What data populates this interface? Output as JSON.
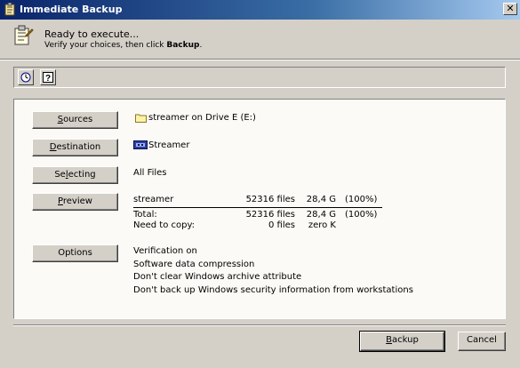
{
  "window": {
    "title": "Immediate Backup",
    "close_label": "✕"
  },
  "header": {
    "line1": "Ready to execute...",
    "line2_prefix": "Verify your choices, then click ",
    "line2_bold": "Backup",
    "line2_suffix": "."
  },
  "toolbar": {
    "icons": [
      "clock-icon",
      "help-icon"
    ]
  },
  "rows": {
    "sources": {
      "button_label_u": "S",
      "button_label_rest": "ources",
      "value": "streamer on Drive E (E:)",
      "icon": "folder-icon"
    },
    "destination": {
      "button_label_u": "D",
      "button_label_rest": "estination",
      "value": "Streamer",
      "icon": "tape-drive-icon"
    },
    "selecting": {
      "button_label_pre": "Se",
      "button_label_u": "l",
      "button_label_rest": "ecting",
      "value": "All Files"
    },
    "preview": {
      "button_label_u": "P",
      "button_label_rest": "review",
      "table": {
        "item": {
          "name": "streamer",
          "files": "52316 files",
          "size": "28,4 G",
          "pct": "(100%)"
        },
        "total": {
          "name": "Total:",
          "files": "52316 files",
          "size": "28,4 G",
          "pct": "(100%)"
        },
        "need": {
          "name": "Need to copy:",
          "files": "0 files",
          "size": "zero K"
        }
      }
    },
    "options": {
      "button_label": "Options",
      "lines": [
        "Verification on",
        "Software data compression",
        "Don't clear Windows archive attribute",
        "Don't back up Windows security information from workstations"
      ]
    }
  },
  "footer": {
    "backup_u": "B",
    "backup_rest": "ackup",
    "cancel_label": "Cancel"
  }
}
